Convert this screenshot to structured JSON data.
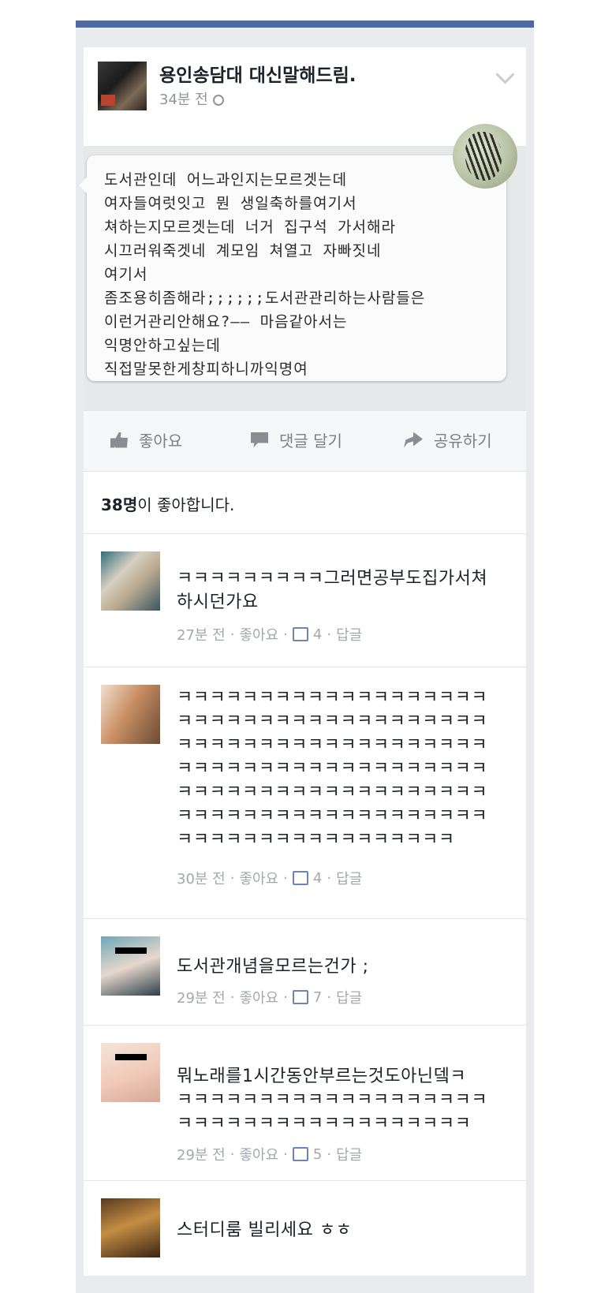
{
  "post": {
    "page_name": "용인송담대 대신말해드림.",
    "time": "34분 전",
    "message_lines": "도서관인데 어느과인지는모르겟는데\n여자들여럿잇고 뭔 생일축하를여기서\n쳐하는지모르겟는데 너거 집구석 가서해라\n시끄러워죽겟네 계모임 쳐열고 자빠짓네\n여기서\n좀조용히좀해라;;;;;;도서관관리하는사람들은\n이런거관리안해요?—— 마음같아서는\n익명안하고싶는데\n직접말못한게창피하니까익명여"
  },
  "actions": {
    "like": "좋아요",
    "comment": "댓글 달기",
    "share": "공유하기"
  },
  "likes": {
    "count": "38명",
    "suffix": "이 좋아합니다."
  },
  "comments": [
    {
      "text": "ㅋㅋㅋㅋㅋㅋㅋㅋㅋ그러면공부도집가서쳐\n하시던가요",
      "time": "27분 전",
      "like": "좋아요",
      "likes": "4",
      "reply": "답글"
    },
    {
      "text": "ㅋㅋㅋㅋㅋㅋㅋㅋㅋㅋㅋㅋㅋㅋㅋㅋㅋㅋㅋ\nㅋㅋㅋㅋㅋㅋㅋㅋㅋㅋㅋㅋㅋㅋㅋㅋㅋㅋㅋ\nㅋㅋㅋㅋㅋㅋㅋㅋㅋㅋㅋㅋㅋㅋㅋㅋㅋㅋㅋ\nㅋㅋㅋㅋㅋㅋㅋㅋㅋㅋㅋㅋㅋㅋㅋㅋㅋㅋㅋ\nㅋㅋㅋㅋㅋㅋㅋㅋㅋㅋㅋㅋㅋㅋㅋㅋㅋㅋㅋ\nㅋㅋㅋㅋㅋㅋㅋㅋㅋㅋㅋㅋㅋㅋㅋㅋㅋㅋㅋ\nㅋㅋㅋㅋㅋㅋㅋㅋㅋㅋㅋㅋㅋㅋㅋㅋㅋ",
      "time": "30분 전",
      "like": "좋아요",
      "likes": "4",
      "reply": "답글"
    },
    {
      "text": "도서관개념을모르는건가 ;",
      "time": "29분 전",
      "like": "좋아요",
      "likes": "7",
      "reply": "답글"
    },
    {
      "text": "뭐노래를1시간동안부르는것도아닌뎈ㅋ\nㅋㅋㅋㅋㅋㅋㅋㅋㅋㅋㅋㅋㅋㅋㅋㅋㅋㅋㅋ\nㅋㅋㅋㅋㅋㅋㅋㅋㅋㅋㅋㅋㅋㅋㅋㅋㅋㅋ",
      "time": "29분 전",
      "like": "좋아요",
      "likes": "5",
      "reply": "답글"
    },
    {
      "text": "스터디룸 빌리세요 ㅎㅎ"
    }
  ]
}
